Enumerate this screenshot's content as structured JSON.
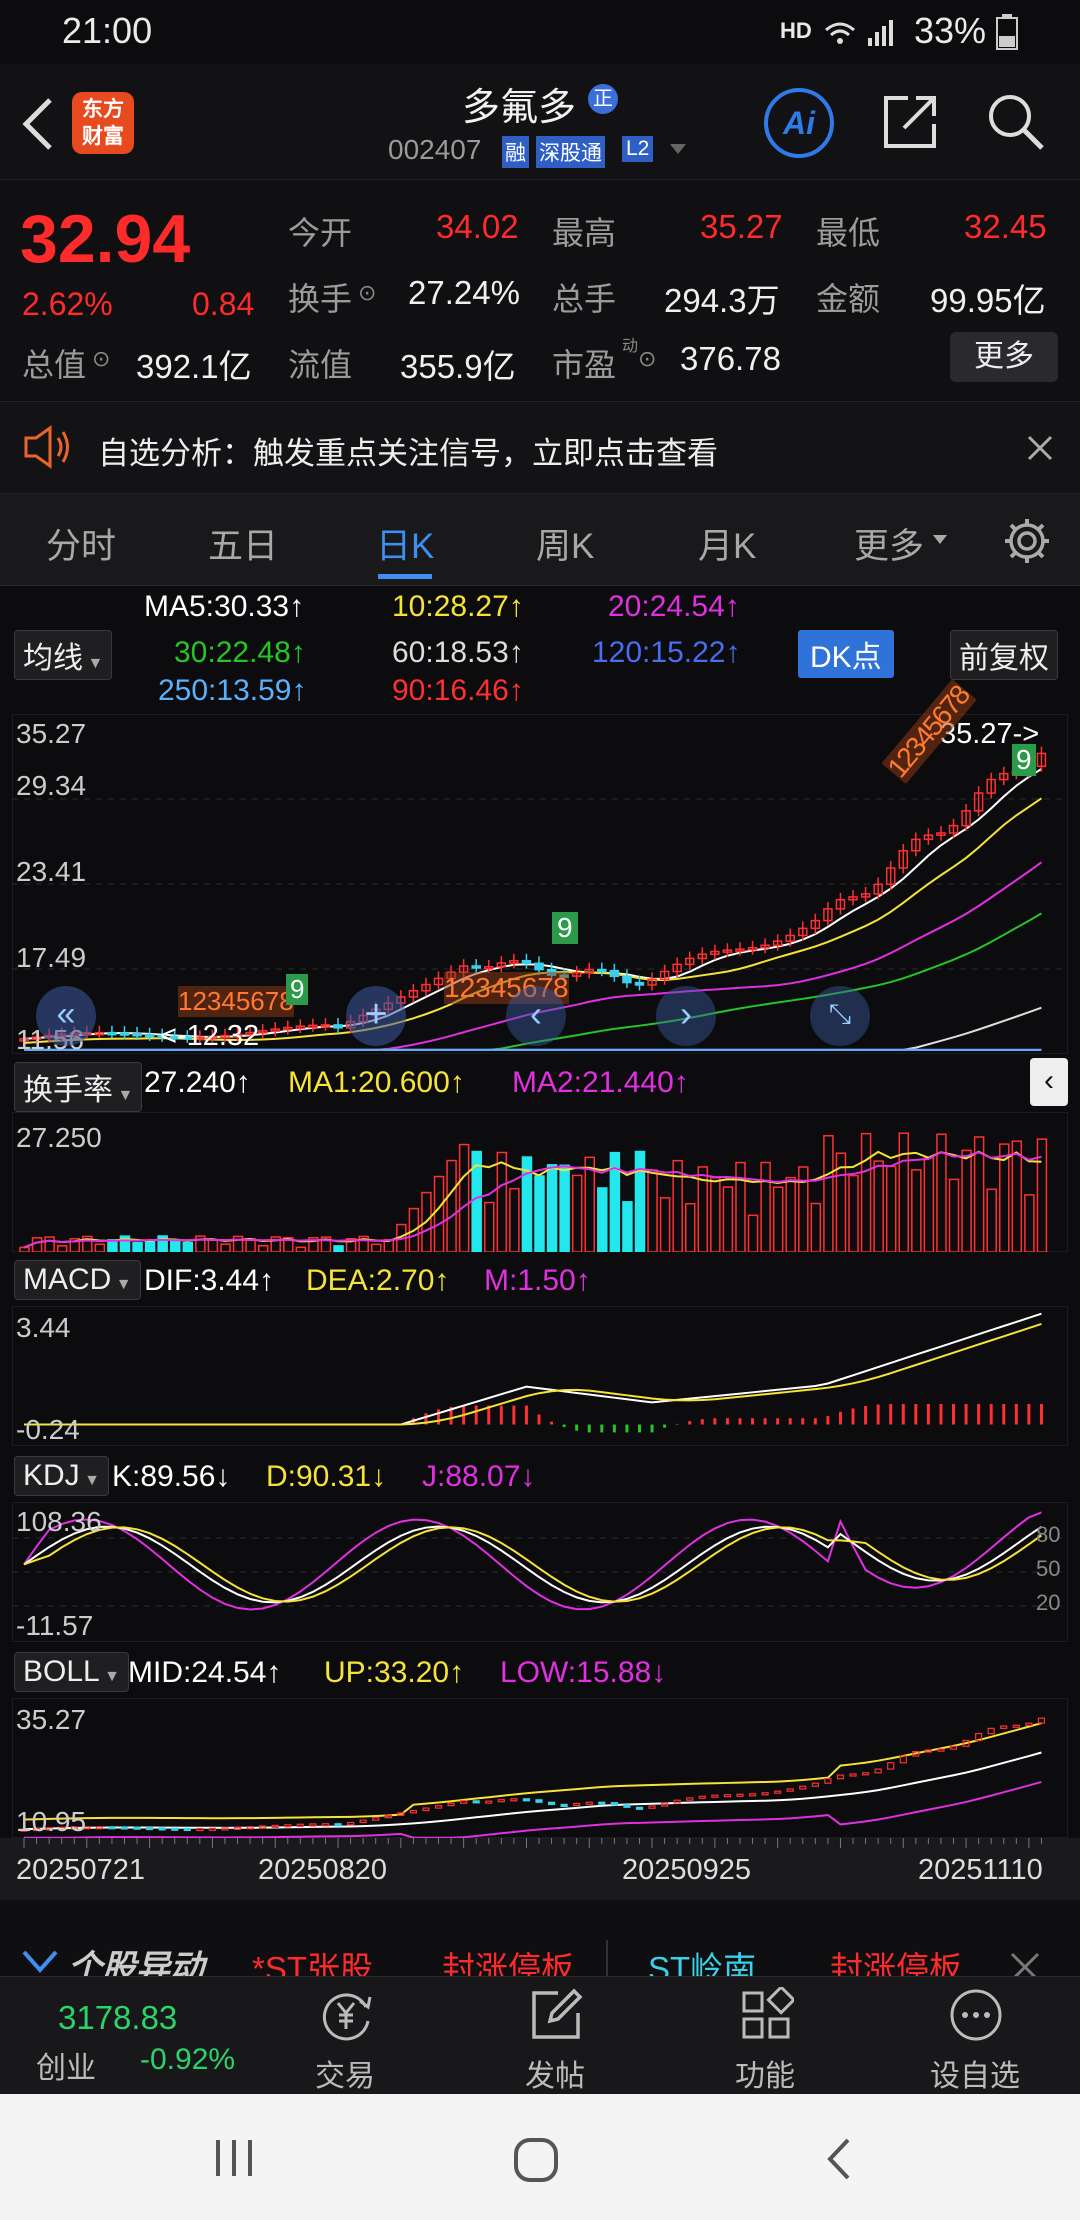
{
  "status": {
    "time": "21:00",
    "network": "HD",
    "battery": "33%"
  },
  "header": {
    "title": "多氟多",
    "badge": "正",
    "code": "002407",
    "tag_margin": "融",
    "tag_connect": "深股通",
    "tag_level": "L2",
    "logo_line1": "东方",
    "logo_line2": "财富",
    "ai_label": "Ai"
  },
  "quote": {
    "price": "32.94",
    "change_pct": "2.62%",
    "change": "0.84",
    "open_label": "今开",
    "open": "34.02",
    "high_label": "最高",
    "high": "35.27",
    "low_label": "最低",
    "low": "32.45",
    "turnover_label": "换手",
    "turnover": "27.24%",
    "volume_label": "总手",
    "volume": "294.3万",
    "amount_label": "金额",
    "amount": "99.95亿",
    "mktcap_label": "总值",
    "mktcap": "392.1亿",
    "float_label": "流值",
    "float": "355.9亿",
    "pe_label": "市盈",
    "pe_sup": "动",
    "pe": "376.78",
    "more": "更多"
  },
  "notice": {
    "text": "自选分析：触发重点关注信号，立即点击查看"
  },
  "tabs": [
    "分时",
    "五日",
    "日K",
    "周K",
    "月K",
    "更多"
  ],
  "ma": {
    "selector": "均线",
    "ma5": "MA5:30.33↑",
    "ma10": "10:28.27↑",
    "ma20": "20:24.54↑",
    "ma30": "30:22.48↑",
    "ma60": "60:18.53↑",
    "ma120": "120:15.22↑",
    "ma250": "250:13.59↑",
    "ma90": "90:16.46↑",
    "dk": "DK点",
    "adjust": "前复权",
    "colors": {
      "ma5": "#ffffff",
      "ma10": "#f5e33a",
      "ma20": "#e030e0",
      "ma30": "#26c426",
      "ma60": "#dddddd",
      "ma120": "#4a6cf0",
      "ma250": "#5ab0ff",
      "ma90": "#ff3030"
    }
  },
  "kline": {
    "y_labels": [
      "35.27",
      "29.34",
      "23.41",
      "17.49",
      "11.56"
    ],
    "max_label": "35.27->",
    "min_label": "<-12.32",
    "seq1": "12345678",
    "seq1_end": "9",
    "seq2": "12345678",
    "seq2_end": "9",
    "seq3": "12345678",
    "seq3_end": "9"
  },
  "turnover_panel": {
    "selector": "换手率",
    "value": "27.240↑",
    "ma1": "MA1:20.600↑",
    "ma2": "MA2:21.440↑",
    "top": "27.250"
  },
  "macd": {
    "selector": "MACD",
    "dif": "DIF:3.44↑",
    "dea": "DEA:2.70↑",
    "m": "M:1.50↑",
    "top": "3.44",
    "bottom": "-0.24"
  },
  "kdj": {
    "selector": "KDJ",
    "k": "K:89.56↓",
    "d": "D:90.31↓",
    "j": "J:88.07↓",
    "top": "108.36",
    "bottom": "-11.57",
    "lvl80": "80",
    "lvl50": "50",
    "lvl20": "20"
  },
  "boll": {
    "selector": "BOLL",
    "mid": "MID:24.54↑",
    "up": "UP:33.20↑",
    "low": "LOW:15.88↓",
    "top": "35.27",
    "bottom": "10.95"
  },
  "dates": [
    "20250721",
    "20250820",
    "20250925",
    "20251110"
  ],
  "ticker": {
    "title": "个股异动",
    "item1": "*ST张股",
    "item1_status": "封涨停板",
    "item2": "ST岭南",
    "item2_status": "封涨停板"
  },
  "bottom": {
    "index_value": "3178.83",
    "index_name": "创业",
    "index_change": "-0.92%",
    "trade": "交易",
    "post": "发帖",
    "func": "功能",
    "watch": "设自选"
  }
}
